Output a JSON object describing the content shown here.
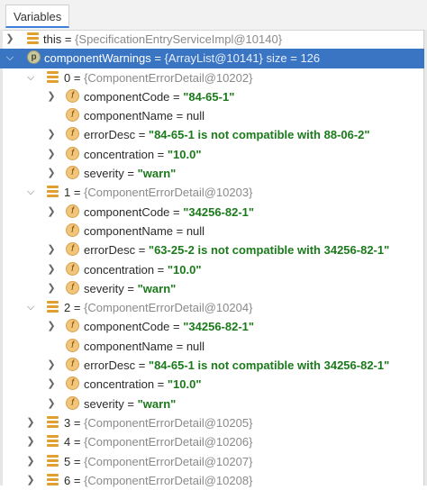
{
  "panel": {
    "tab_label": "Variables"
  },
  "rows": [
    {
      "key": "this",
      "eq": " = ",
      "type": "{SpecificationEntryServiceImpl@10140}"
    },
    {
      "key": "componentWarnings",
      "eq": " = ",
      "type": "{ArrayList@10141}",
      "extra": "  size = 126"
    },
    {
      "key": "0",
      "eq": " = ",
      "type": "{ComponentErrorDetail@10202}"
    },
    {
      "key": "componentCode",
      "eq": " = ",
      "str": "\"84-65-1\""
    },
    {
      "key": "componentName",
      "eq": " = ",
      "plain": "null"
    },
    {
      "key": "errorDesc",
      "eq": " = ",
      "str": "\"84-65-1 is not compatible with 88-06-2\""
    },
    {
      "key": "concentration",
      "eq": " = ",
      "str": "\"10.0\""
    },
    {
      "key": "severity",
      "eq": " = ",
      "str": "\"warn\""
    },
    {
      "key": "1",
      "eq": " = ",
      "type": "{ComponentErrorDetail@10203}"
    },
    {
      "key": "componentCode",
      "eq": " = ",
      "str": "\"34256-82-1\""
    },
    {
      "key": "componentName",
      "eq": " = ",
      "plain": "null"
    },
    {
      "key": "errorDesc",
      "eq": " = ",
      "str": "\"63-25-2 is not compatible with 34256-82-1\""
    },
    {
      "key": "concentration",
      "eq": " = ",
      "str": "\"10.0\""
    },
    {
      "key": "severity",
      "eq": " = ",
      "str": "\"warn\""
    },
    {
      "key": "2",
      "eq": " = ",
      "type": "{ComponentErrorDetail@10204}"
    },
    {
      "key": "componentCode",
      "eq": " = ",
      "str": "\"34256-82-1\""
    },
    {
      "key": "componentName",
      "eq": " = ",
      "plain": "null"
    },
    {
      "key": "errorDesc",
      "eq": " = ",
      "str": "\"84-65-1 is not compatible with 34256-82-1\""
    },
    {
      "key": "concentration",
      "eq": " = ",
      "str": "\"10.0\""
    },
    {
      "key": "severity",
      "eq": " = ",
      "str": "\"warn\""
    },
    {
      "key": "3",
      "eq": " = ",
      "type": "{ComponentErrorDetail@10205}"
    },
    {
      "key": "4",
      "eq": " = ",
      "type": "{ComponentErrorDetail@10206}"
    },
    {
      "key": "5",
      "eq": " = ",
      "type": "{ComponentErrorDetail@10207}"
    },
    {
      "key": "6",
      "eq": " = ",
      "type": "{ComponentErrorDetail@10208}"
    }
  ],
  "icons": {
    "field": "field-lines-icon",
    "f": "field-f-icon",
    "p": "property-p-icon",
    "chev_right": "chevron-right-icon",
    "chev_down": "chevron-down-icon"
  },
  "colors": {
    "selection": "#3a75c4",
    "string": "#1b7a1b",
    "muted": "#8a8a8a",
    "field_icon": "#e0a030",
    "f_badge": "#f1c57a"
  }
}
